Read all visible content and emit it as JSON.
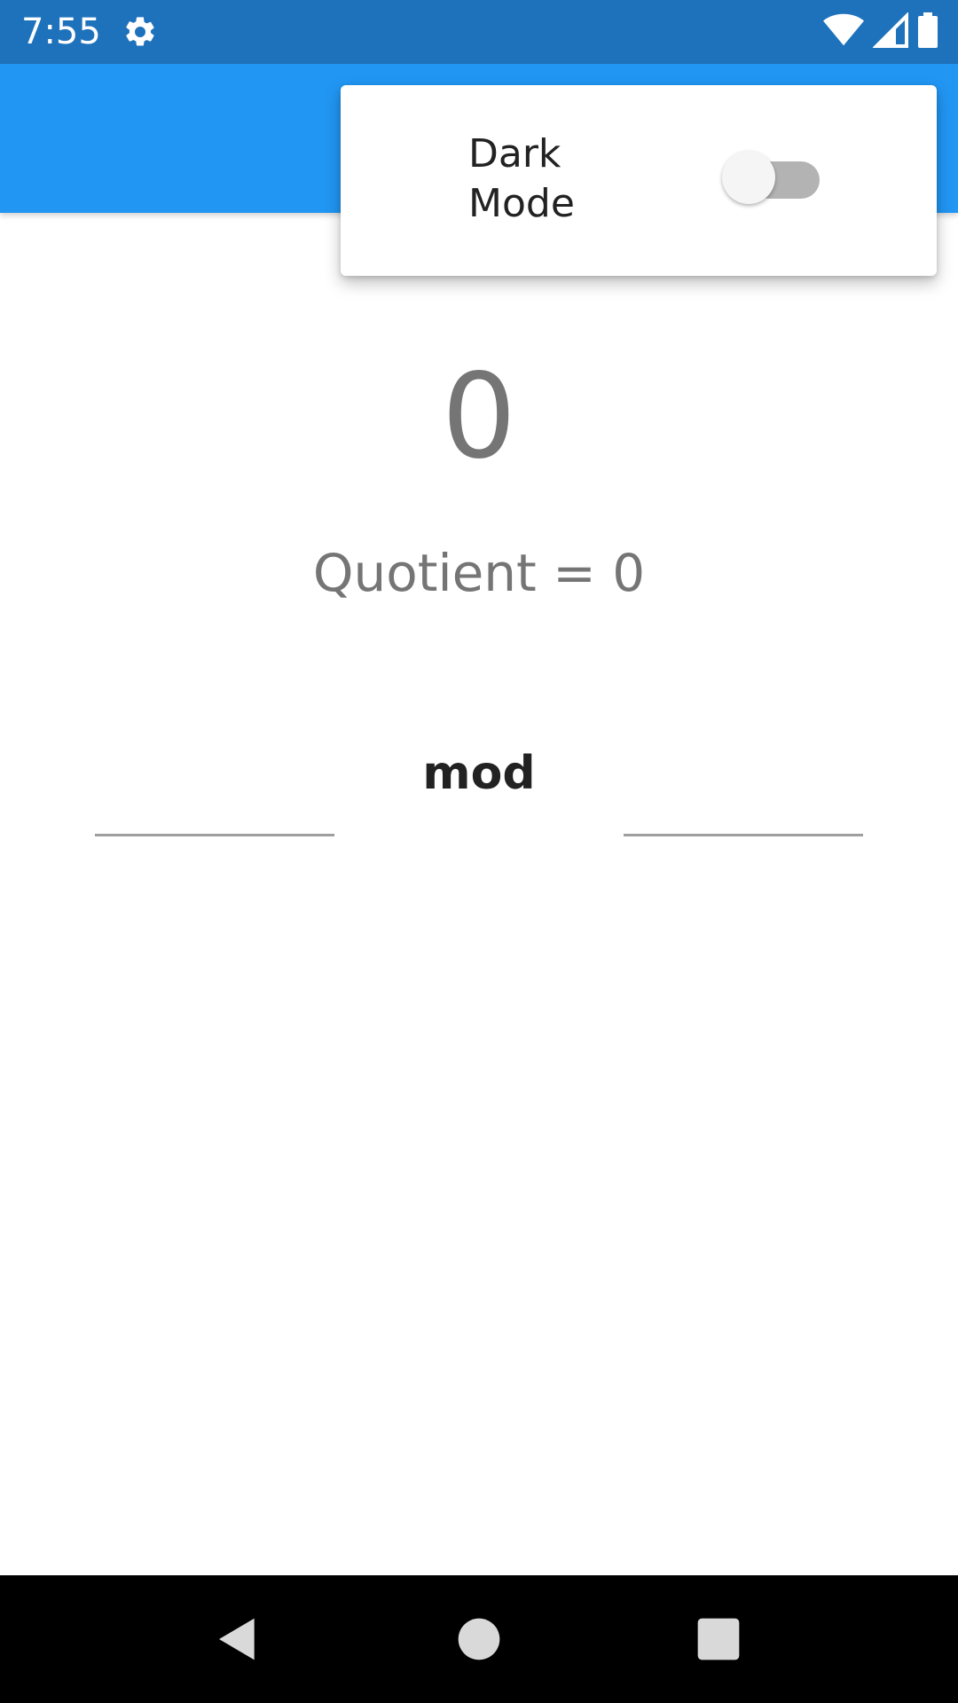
{
  "status_bar": {
    "time": "7:55",
    "icons": [
      "gear-icon",
      "wifi-icon",
      "cellular-signal-icon",
      "battery-icon"
    ]
  },
  "menu": {
    "dark_mode_label": "Dark Mode",
    "dark_mode_enabled": false
  },
  "main": {
    "result": "0",
    "quotient": "Quotient = 0",
    "operator_label": "mod",
    "left_input_value": "",
    "right_input_value": ""
  },
  "nav_bar": {
    "icons": [
      "back-icon",
      "home-icon",
      "recents-icon"
    ]
  },
  "colors": {
    "status_bar": "#1e72bc",
    "app_bar": "#2196f3",
    "switch_track": "#b3b3b3",
    "text_secondary": "#757575"
  }
}
